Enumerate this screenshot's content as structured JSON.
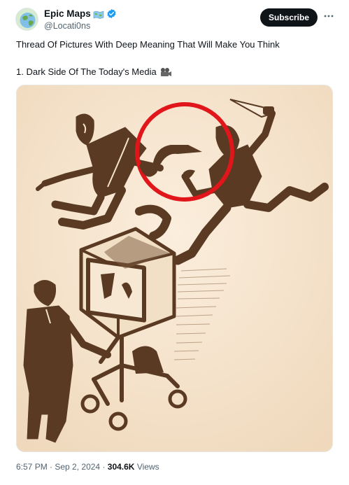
{
  "author": {
    "display_name": "Epic Maps",
    "name_emoji": "map-emoji-icon",
    "verified": "verified-badge-icon",
    "handle": "@Locati0ns"
  },
  "actions": {
    "subscribe_label": "Subscribe",
    "more_icon": "more-icon"
  },
  "tweet": {
    "line1": "Thread Of Pictures With Deep Meaning That Will Make You Think",
    "line2": "1. Dark Side Of The Today's Media",
    "line2_emoji": "movie-camera-icon"
  },
  "media": {
    "description_icon": "illustration-image",
    "colors": {
      "paper": "#f6e6cf",
      "ink": "#5a3a22",
      "circle": "#e0161b"
    }
  },
  "meta": {
    "time": "6:57 PM",
    "separator1": " · ",
    "date": "Sep 2, 2024",
    "separator2": " · ",
    "views_count": "304.6K",
    "views_label": " Views"
  },
  "colors": {
    "text": "#0f1419",
    "secondary": "#536471",
    "button": "#0f1419",
    "verified": "#1d9bf0"
  }
}
